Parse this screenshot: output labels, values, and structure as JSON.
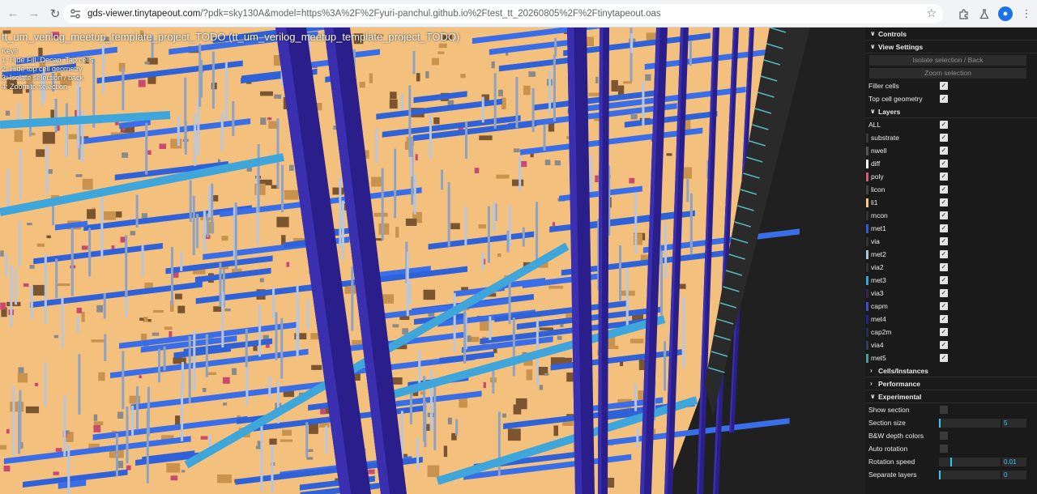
{
  "browser": {
    "url_host": "gds-viewer.tinytapeout.com",
    "url_rest": "/?pdk=sky130A&model=https%3A%2F%2Fyuri-panchul.github.io%2Ftest_tt_20260805%2F%2Ftinytapeout.oas",
    "icons": [
      "back-icon",
      "forward-icon",
      "reload-icon",
      "site-info-icon",
      "bookmark-star-icon",
      "extensions-icon",
      "labs-icon",
      "profile-icon",
      "more-menu-icon"
    ]
  },
  "viewport": {
    "title": "tt_um_verilog_meetup_template_project_TODO (tt_um_verilog_meetup_template_project_TODO)",
    "keys": [
      "Keys",
      "1: Hide Fill, Decap, Tap cells",
      "2: Hide top cell geometry",
      "3: Isolate selection / back",
      "4: Zoom to selection"
    ]
  },
  "panel": {
    "controls_label": "Controls",
    "view_settings": {
      "label": "View Settings",
      "isolate_btn": "Isolate selection / Back",
      "zoom_btn": "Zoom selection",
      "filler_label": "Filler cells",
      "filler_checked": true,
      "topcell_label": "Top cell geometry",
      "topcell_checked": true
    },
    "layers": {
      "label": "Layers",
      "all_label": "ALL",
      "items": [
        {
          "name": "substrate",
          "color": "#3a3a3a"
        },
        {
          "name": "nwell",
          "color": "#555555"
        },
        {
          "name": "diff",
          "color": "#f4f4f4"
        },
        {
          "name": "poly",
          "color": "#d95a7a"
        },
        {
          "name": "licon",
          "color": "#444444"
        },
        {
          "name": "li1",
          "color": "#ffc87a"
        },
        {
          "name": "mcon",
          "color": "#333333"
        },
        {
          "name": "met1",
          "color": "#2a5fd6"
        },
        {
          "name": "via",
          "color": "#333333"
        },
        {
          "name": "met2",
          "color": "#a9c4e8"
        },
        {
          "name": "via2",
          "color": "#333333"
        },
        {
          "name": "met3",
          "color": "#34a7d8"
        },
        {
          "name": "via3",
          "color": "#3a1f5a"
        },
        {
          "name": "capm",
          "color": "#3a4fd0"
        },
        {
          "name": "met4",
          "color": "#2a1f8a"
        },
        {
          "name": "cap2m",
          "color": "#2a2a55"
        },
        {
          "name": "via4",
          "color": "#3a3a5a"
        },
        {
          "name": "met5",
          "color": "#46a0a0"
        }
      ]
    },
    "cells_label": "Cells/Instances",
    "performance_label": "Performance",
    "experimental": {
      "label": "Experimental",
      "show_section_label": "Show section",
      "section_size_label": "Section size",
      "section_size_value": "5",
      "bw_label": "B&W depth colors",
      "auto_rotation_label": "Auto rotation",
      "rotation_speed_label": "Rotation speed",
      "rotation_speed_value": "0.01",
      "separate_layers_label": "Separate layers",
      "separate_layers_value": "0"
    }
  }
}
